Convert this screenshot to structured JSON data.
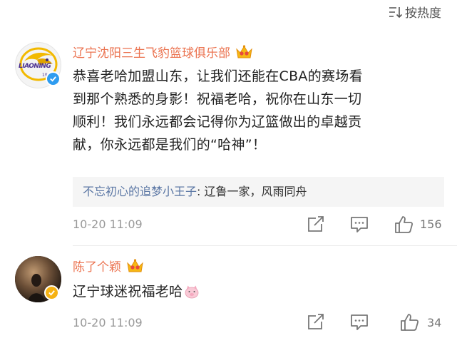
{
  "sort": {
    "label": "按热度"
  },
  "comments": [
    {
      "username": "辽宁沈阳三生飞豹篮球俱乐部",
      "avatar_text": "LIAONING",
      "avatar_sub": "1995",
      "content_lines": [
        "恭喜老哈加盟山东，让我们还能在CBA的赛场看",
        "到那个熟悉的身影！祝福老哈，祝你在山东一切",
        "顺利！我们永远都会记得你为辽篮做出的卓越贡",
        "献，你永远都是我们的“哈神”！"
      ],
      "reply": {
        "name": "不忘初心的追梦小王子",
        "separator": ":",
        "text": " 辽鲁一家，风雨同舟"
      },
      "time": "10-20 11:09",
      "likes": "156"
    },
    {
      "username": "陈了个颖",
      "content": "辽宁球迷祝福老哈",
      "time": "10-20 11:09",
      "likes": "34"
    }
  ],
  "colors": {
    "username": "#eb7350",
    "reply_name": "#5a76a4",
    "meta": "#999999"
  }
}
